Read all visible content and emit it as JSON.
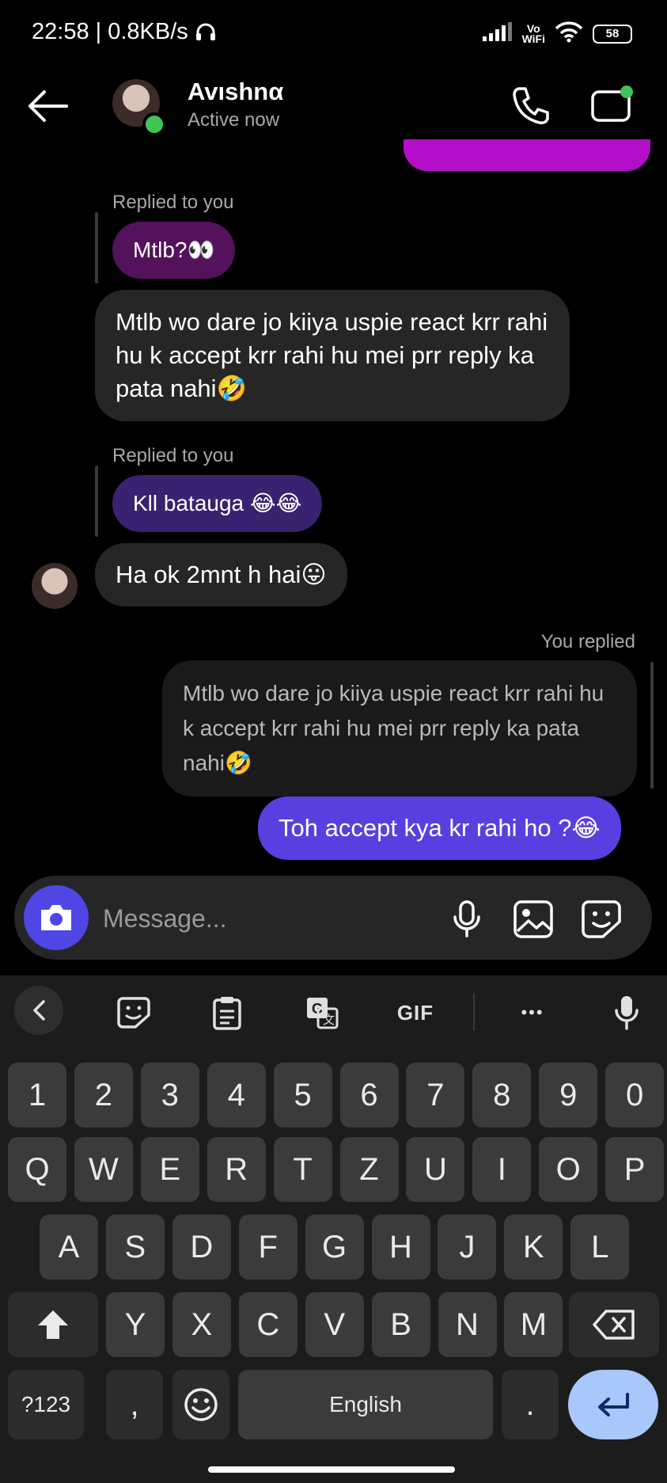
{
  "status_bar": {
    "time": "22:58 | 0.8KB/s",
    "volte_top": "Vo",
    "volte_bottom": "WiFi",
    "battery": "58"
  },
  "header": {
    "contact_name": "Avıshnα",
    "contact_status": "Active now"
  },
  "chat": {
    "replied_to_you_1": "Replied to you",
    "quoted_1": "Mtlb?👀",
    "message_1": "Mtlb wo dare jo kiiya uspie react krr rahi hu k accept krr rahi hu mei prr reply ka pata nahi🤣",
    "replied_to_you_2": "Replied to you",
    "quoted_2": "Kll batauga 😂😂",
    "message_2": "Ha ok 2mnt h hai😛",
    "you_replied": "You replied",
    "quoted_3": "Mtlb wo dare jo kiiya uspie react krr rahi hu k accept krr rahi hu mei prr reply ka pata nahi🤣",
    "message_3": "Toh accept kya kr rahi ho ?😂"
  },
  "composer": {
    "placeholder": "Message..."
  },
  "keyboard": {
    "toolbar_gif": "GIF",
    "toolbar_more": "•••",
    "number_row": [
      "1",
      "2",
      "3",
      "4",
      "5",
      "6",
      "7",
      "8",
      "9",
      "0"
    ],
    "row_1": [
      "Q",
      "W",
      "E",
      "R",
      "T",
      "Z",
      "U",
      "I",
      "O",
      "P"
    ],
    "row_2": [
      "A",
      "S",
      "D",
      "F",
      "G",
      "H",
      "J",
      "K",
      "L"
    ],
    "row_3": [
      "Y",
      "X",
      "C",
      "V",
      "B",
      "N",
      "M"
    ],
    "symbols_key": "?123",
    "comma_key": ",",
    "space_key": "English",
    "period_key": "."
  },
  "colors": {
    "outgoing_bubble": "#5a3fe0",
    "incoming_bubble": "#262626",
    "online_dot": "#3fc556",
    "enter_key": "#a8c7fa"
  }
}
